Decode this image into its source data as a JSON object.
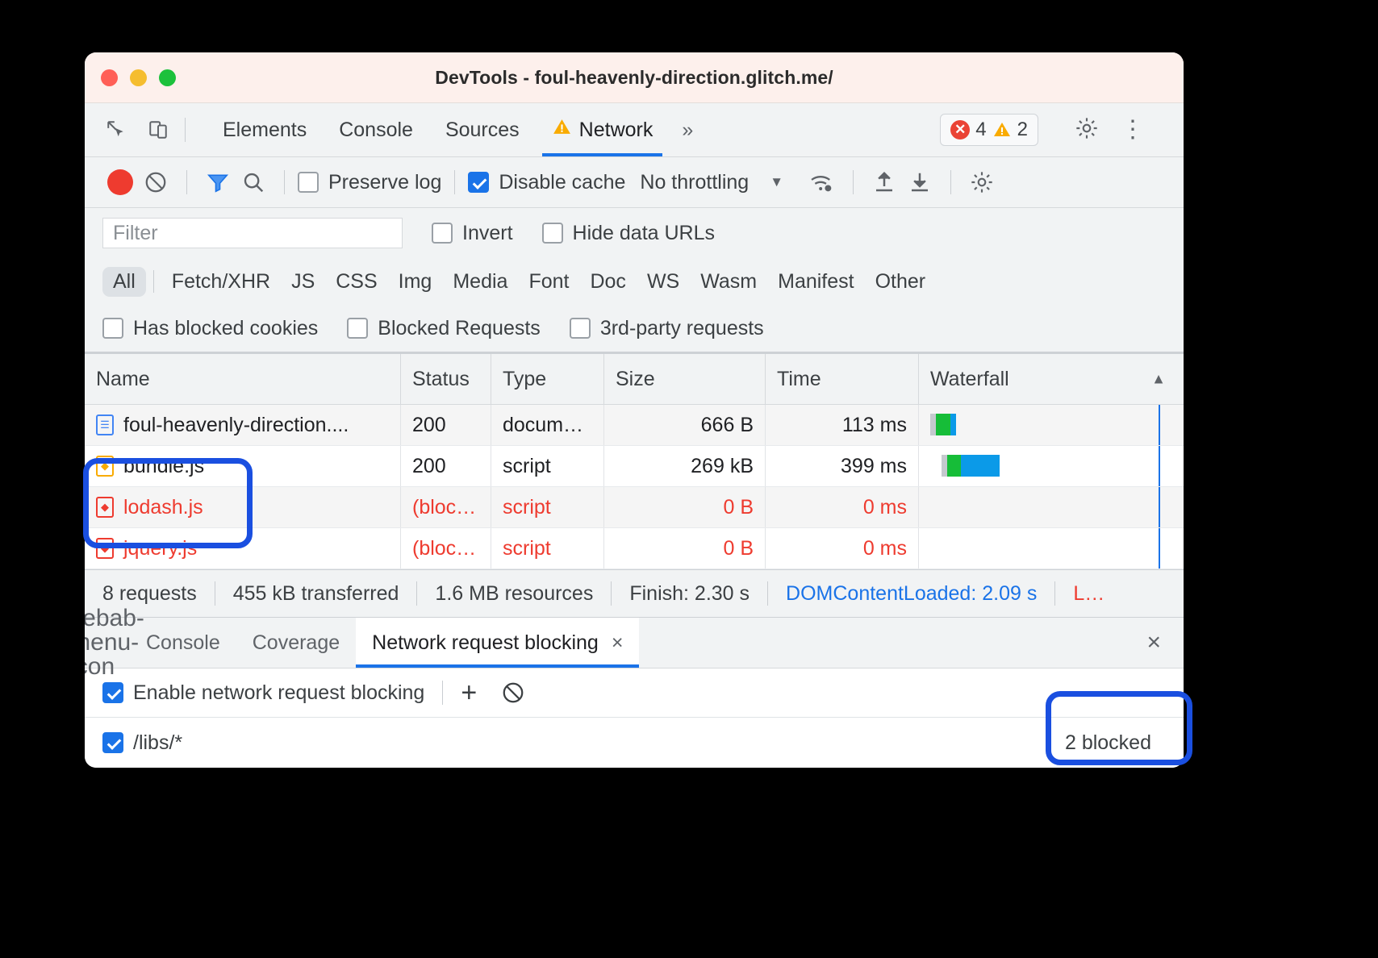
{
  "window": {
    "title": "DevTools - foul-heavenly-direction.glitch.me/"
  },
  "tabstrip": {
    "inspect_icon": "inspect-element-icon",
    "device_icon": "device-toolbar-icon",
    "tabs": [
      {
        "label": "Elements",
        "active": false
      },
      {
        "label": "Console",
        "active": false
      },
      {
        "label": "Sources",
        "active": false
      },
      {
        "label": "Network",
        "active": true,
        "warning": true
      }
    ],
    "more_tabs": "»",
    "errors": "4",
    "warnings": "2",
    "settings_icon": "gear-icon",
    "menu_icon": "kebab-menu-icon"
  },
  "network_toolbar": {
    "record_label": "record-button",
    "clear_label": "clear-button",
    "filter_icon": "filter-icon",
    "search_icon": "search-icon",
    "preserve_log": {
      "label": "Preserve log",
      "checked": false
    },
    "disable_cache": {
      "label": "Disable cache",
      "checked": true
    },
    "throttling": "No throttling",
    "throttling_caret": "▼",
    "wifi_icon": "network-conditions-icon",
    "import_icon": "upload-har-icon",
    "export_icon": "download-har-icon",
    "settings_icon": "gear-icon"
  },
  "filter_bar": {
    "placeholder": "Filter",
    "value": "",
    "invert": {
      "label": "Invert",
      "checked": false
    },
    "hide_data_urls": {
      "label": "Hide data URLs",
      "checked": false
    }
  },
  "type_filters": [
    {
      "label": "All",
      "selected": true
    },
    {
      "label": "Fetch/XHR",
      "selected": false
    },
    {
      "label": "JS",
      "selected": false
    },
    {
      "label": "CSS",
      "selected": false
    },
    {
      "label": "Img",
      "selected": false
    },
    {
      "label": "Media",
      "selected": false
    },
    {
      "label": "Font",
      "selected": false
    },
    {
      "label": "Doc",
      "selected": false
    },
    {
      "label": "WS",
      "selected": false
    },
    {
      "label": "Wasm",
      "selected": false
    },
    {
      "label": "Manifest",
      "selected": false
    },
    {
      "label": "Other",
      "selected": false
    }
  ],
  "blocked_filters": [
    {
      "label": "Has blocked cookies",
      "checked": false
    },
    {
      "label": "Blocked Requests",
      "checked": false
    },
    {
      "label": "3rd-party requests",
      "checked": false
    }
  ],
  "table": {
    "columns": [
      "Name",
      "Status",
      "Type",
      "Size",
      "Time",
      "Waterfall"
    ],
    "sort_arrow": "▲",
    "rows": [
      {
        "icon": "document-icon",
        "name": "foul-heavenly-direction....",
        "status": "200",
        "type": "docum…",
        "size": "666 B",
        "time": "113 ms",
        "blocked": false
      },
      {
        "icon": "script-icon",
        "name": "bundle.js",
        "status": "200",
        "type": "script",
        "size": "269 kB",
        "time": "399 ms",
        "blocked": false
      },
      {
        "icon": "script-blocked-icon",
        "name": "lodash.js",
        "status": "(bloc…",
        "type": "script",
        "size": "0 B",
        "time": "0 ms",
        "blocked": true
      },
      {
        "icon": "script-blocked-icon",
        "name": "jquery.js",
        "status": "(bloc…",
        "type": "script",
        "size": "0 B",
        "time": "0 ms",
        "blocked": true
      }
    ]
  },
  "summary": {
    "requests": "8 requests",
    "transferred": "455 kB transferred",
    "resources": "1.6 MB resources",
    "finish": "Finish: 2.30 s",
    "dom_content_loaded": "DOMContentLoaded: 2.09 s",
    "load": "L…"
  },
  "drawer": {
    "menu_icon": "kebab-menu-icon",
    "tabs": [
      {
        "label": "Console",
        "active": false,
        "closable": false
      },
      {
        "label": "Coverage",
        "active": false,
        "closable": false
      },
      {
        "label": "Network request blocking",
        "active": true,
        "closable": true
      }
    ],
    "tab_close": "×",
    "close_drawer": "×",
    "enable_blocking": {
      "label": "Enable network request blocking",
      "checked": true
    },
    "add_pattern_icon": "+",
    "remove_all_icon": "block-icon",
    "patterns": [
      {
        "checked": true,
        "value": "/libs/*",
        "blocked_count": "2 blocked"
      }
    ]
  },
  "colors": {
    "accent": "#1a73e8",
    "error": "#ee3b2f",
    "warning": "#f9ab00",
    "annotation": "#1a4fe0",
    "waterfall_green": "#16bd38",
    "waterfall_blue": "#0b9ae8"
  }
}
